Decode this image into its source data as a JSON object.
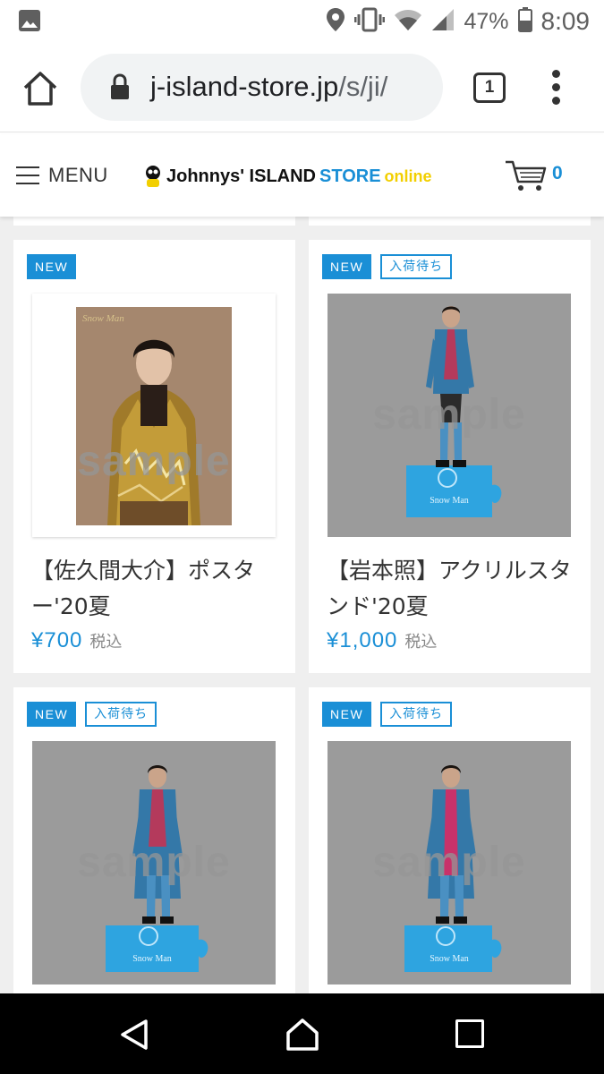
{
  "status_bar": {
    "battery": "47%",
    "time": "8:09"
  },
  "browser": {
    "url_host": "j-island-store.jp",
    "url_path": "/s/ji/",
    "tab_count": "1"
  },
  "header": {
    "menu_label": "MENU",
    "logo_main": "Johnnys' ISLAND",
    "logo_store": "STORE",
    "logo_online": "online",
    "cart_count": "0"
  },
  "products": [
    {
      "badges": [
        "NEW"
      ],
      "title": "【佐久間大介】ポスター'20夏",
      "price": "¥700",
      "tax": "税込",
      "image": "poster-photo",
      "sample": "sample"
    },
    {
      "badges": [
        "NEW",
        "入荷待ち"
      ],
      "title": "【岩本照】アクリルスタンド'20夏",
      "price": "¥1,000",
      "tax": "税込",
      "image": "acrylic-stand-photo",
      "sample": "sample"
    },
    {
      "badges": [
        "NEW",
        "入荷待ち"
      ],
      "title": "",
      "price": "",
      "tax": "",
      "image": "acrylic-stand-photo",
      "sample": "sample"
    },
    {
      "badges": [
        "NEW",
        "入荷待ち"
      ],
      "title": "",
      "price": "",
      "tax": "",
      "image": "acrylic-stand-photo",
      "sample": "sample"
    }
  ],
  "colors": {
    "accent": "#1a8fd6",
    "logo_yellow": "#f2cf00",
    "page_bg": "#efefef"
  }
}
